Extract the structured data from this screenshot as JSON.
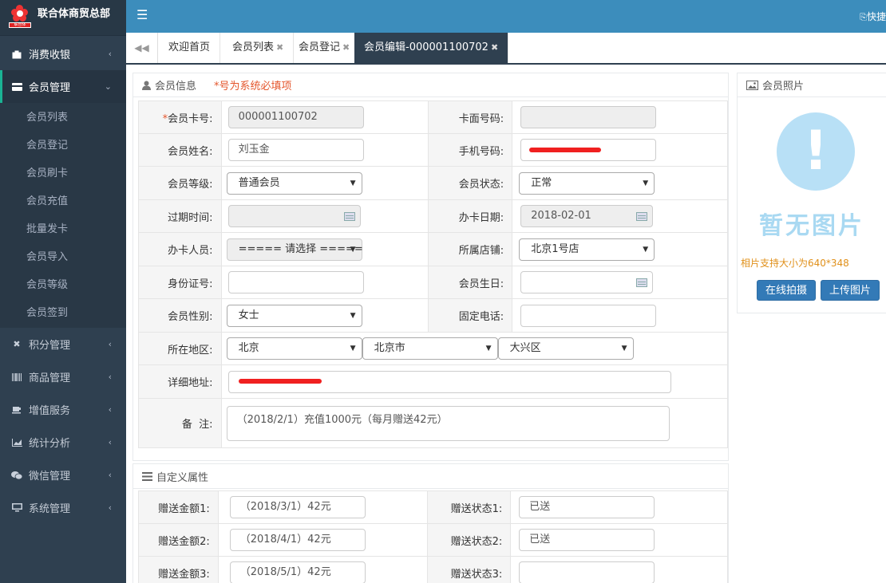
{
  "brand": {
    "name": "联合体商贸总部",
    "logo_text": "联合体"
  },
  "topbar": {
    "menu_icon": "menu-icon",
    "right_text": "快捷"
  },
  "sidebar": {
    "items": [
      {
        "label": "消费收银",
        "icon": "bag-icon",
        "chevron": "‹"
      },
      {
        "label": "会员管理",
        "icon": "member-card-icon",
        "chevron": "⌄"
      },
      {
        "label": "积分管理",
        "icon": "points-icon",
        "chevron": "‹"
      },
      {
        "label": "商品管理",
        "icon": "barcode-icon",
        "chevron": "‹"
      },
      {
        "label": "增值服务",
        "icon": "cup-icon",
        "chevron": "‹"
      },
      {
        "label": "统计分析",
        "icon": "chart-icon",
        "chevron": "‹"
      },
      {
        "label": "微信管理",
        "icon": "wechat-icon",
        "chevron": "‹"
      },
      {
        "label": "系统管理",
        "icon": "monitor-icon",
        "chevron": "‹"
      }
    ],
    "sub_items": [
      "会员列表",
      "会员登记",
      "会员刷卡",
      "会员充值",
      "批量发卡",
      "会员导入",
      "会员等级",
      "会员签到"
    ]
  },
  "tabs": [
    {
      "label": "欢迎首页",
      "closable": false
    },
    {
      "label": "会员列表",
      "closable": true
    },
    {
      "label": "会员登记",
      "closable": true
    },
    {
      "label": "会员编辑-000001100702",
      "closable": true,
      "active": true
    }
  ],
  "member_info": {
    "title": "会员信息",
    "required_note": "*号为系统必填项",
    "labels": {
      "card_no": "会员卡号:",
      "face_no": "卡面号码:",
      "name": "会员姓名:",
      "mobile": "手机号码:",
      "level": "会员等级:",
      "status": "会员状态:",
      "expire": "过期时间:",
      "open_date": "办卡日期:",
      "staff": "办卡人员:",
      "store": "所属店铺:",
      "id_no": "身份证号:",
      "birthday": "会员生日:",
      "gender": "会员性别:",
      "phone": "固定电话:",
      "region": "所在地区:",
      "address": "详细地址:",
      "remark": "备  注:"
    },
    "required_mark": "*",
    "values": {
      "card_no": "000001100702",
      "face_no": "",
      "name": "刘玉金",
      "mobile": "",
      "level": "普通会员",
      "status": "正常",
      "expire": "",
      "open_date": "2018-02-01",
      "staff": "===== 请选择 =====",
      "store": "北京1号店",
      "id_no": "",
      "birthday": "",
      "gender": "女士",
      "phone": "",
      "province": "北京",
      "city": "北京市",
      "district": "大兴区",
      "address": "",
      "remark": "（2018/2/1）充值1000元（每月赠送42元）"
    }
  },
  "custom_attrs": {
    "title": "自定义属性",
    "rows": [
      {
        "amount_label": "赠送金额1:",
        "amount": "（2018/3/1）42元",
        "state_label": "赠送状态1:",
        "state": "已送"
      },
      {
        "amount_label": "赠送金额2:",
        "amount": "（2018/4/1）42元",
        "state_label": "赠送状态2:",
        "state": "已送"
      },
      {
        "amount_label": "赠送金额3:",
        "amount": "（2018/5/1）42元",
        "state_label": "赠送状态3:",
        "state": ""
      }
    ]
  },
  "photo": {
    "title": "会员照片",
    "placeholder_mark": "!",
    "placeholder_text": "暂无图片",
    "hint": "相片支持大小为640*348",
    "btn_capture": "在线拍摄",
    "btn_upload": "上传图片"
  },
  "colors": {
    "sidebar": "#2f4050",
    "topbar": "#3c8dbc",
    "accent": "#1ab394",
    "required": "#e4572e",
    "button": "#337ab7",
    "redaction": "#f02020"
  }
}
